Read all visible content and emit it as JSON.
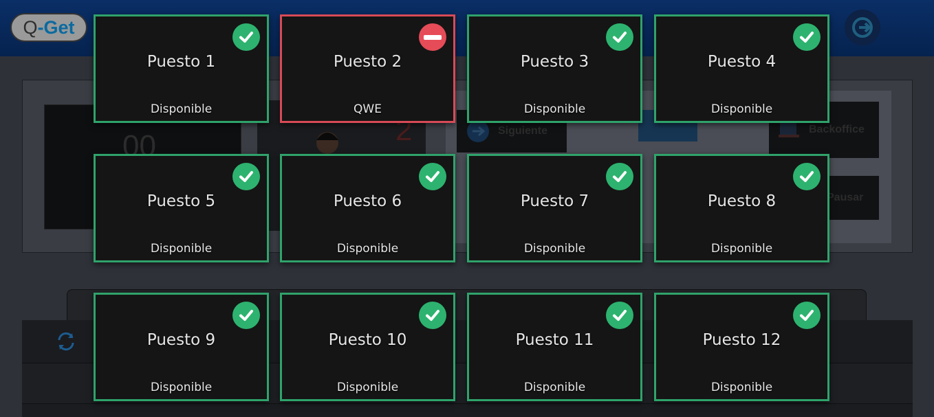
{
  "app": {
    "logo_prefix": "Q",
    "logo_accent": "-Get"
  },
  "background": {
    "counter": "00",
    "agent_number": "2",
    "buttons": {
      "siguiente": "Siguiente",
      "backoffice": "Backoffice",
      "pausar": "Pausar"
    }
  },
  "desks": [
    {
      "name": "Puesto 1",
      "status": "Disponible",
      "state": "available",
      "icon": "check-circle-icon"
    },
    {
      "name": "Puesto 2",
      "status": "QWE",
      "state": "busy",
      "icon": "no-entry-icon"
    },
    {
      "name": "Puesto 3",
      "status": "Disponible",
      "state": "available",
      "icon": "check-circle-icon"
    },
    {
      "name": "Puesto 4",
      "status": "Disponible",
      "state": "available",
      "icon": "check-circle-icon"
    },
    {
      "name": "Puesto 5",
      "status": "Disponible",
      "state": "available",
      "icon": "check-circle-icon"
    },
    {
      "name": "Puesto 6",
      "status": "Disponible",
      "state": "available",
      "icon": "check-circle-icon"
    },
    {
      "name": "Puesto 7",
      "status": "Disponible",
      "state": "available",
      "icon": "check-circle-icon"
    },
    {
      "name": "Puesto 8",
      "status": "Disponible",
      "state": "available",
      "icon": "check-circle-icon"
    },
    {
      "name": "Puesto 9",
      "status": "Disponible",
      "state": "available",
      "icon": "check-circle-icon"
    },
    {
      "name": "Puesto 10",
      "status": "Disponible",
      "state": "available",
      "icon": "check-circle-icon"
    },
    {
      "name": "Puesto 11",
      "status": "Disponible",
      "state": "available",
      "icon": "check-circle-icon"
    },
    {
      "name": "Puesto 12",
      "status": "Disponible",
      "state": "available",
      "icon": "check-circle-icon"
    }
  ],
  "colors": {
    "available": "#2fa36b",
    "busy": "#d84a57",
    "tile_bg": "#151515"
  }
}
